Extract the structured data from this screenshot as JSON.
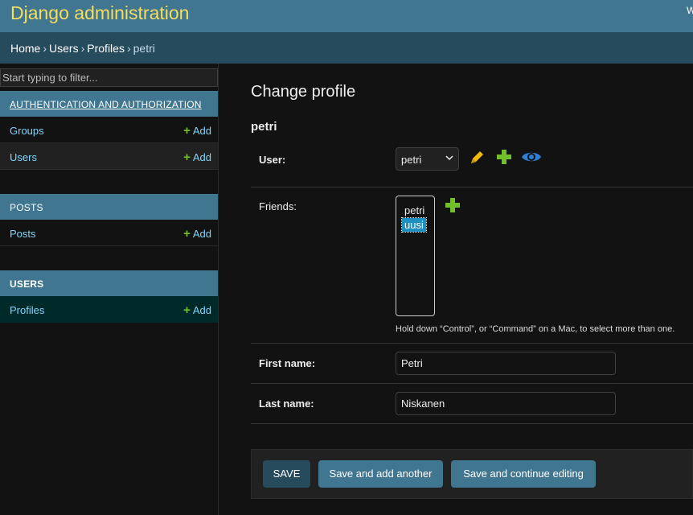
{
  "header": {
    "site_name": "Django administration",
    "user_tools": "W"
  },
  "breadcrumbs": {
    "home": "Home",
    "users": "Users",
    "profiles": "Profiles",
    "current": "petri",
    "separator": "›"
  },
  "sidebar": {
    "filter_placeholder": "Start typing to filter...",
    "apps": [
      {
        "caption": "AUTHENTICATION AND AUTHORIZATION",
        "models": [
          {
            "name": "Groups",
            "add": "Add"
          },
          {
            "name": "Users",
            "add": "Add"
          }
        ]
      },
      {
        "caption": "POSTS",
        "models": [
          {
            "name": "Posts",
            "add": "Add"
          }
        ]
      },
      {
        "caption": "USERS",
        "models": [
          {
            "name": "Profiles",
            "add": "Add"
          }
        ]
      }
    ],
    "add_plus": "+"
  },
  "content": {
    "title": "Change profile",
    "object_name": "petri",
    "fields": {
      "user": {
        "label": "User:",
        "value": "petri"
      },
      "friends": {
        "label": "Friends:",
        "options": [
          "petri",
          "uusi"
        ],
        "selected": "uusi",
        "help": "Hold down “Control”, or “Command” on a Mac, to select more than one."
      },
      "first_name": {
        "label": "First name:",
        "value": "Petri"
      },
      "last_name": {
        "label": "Last name:",
        "value": "Niskanen"
      }
    }
  },
  "submit": {
    "save": "SAVE",
    "save_add": "Save and add another",
    "save_continue": "Save and continue editing"
  },
  "icons": {
    "change": "pencil-icon",
    "add": "plus-icon",
    "view": "eye-icon"
  },
  "colors": {
    "header_bg": "#417690",
    "breadcrumb_bg": "#264b5d",
    "site_name": "#f5dd5d",
    "link": "#81d4fa",
    "add_green": "#70bf2b",
    "pencil": "#efb80b",
    "view_blue": "#2e7fd4"
  }
}
